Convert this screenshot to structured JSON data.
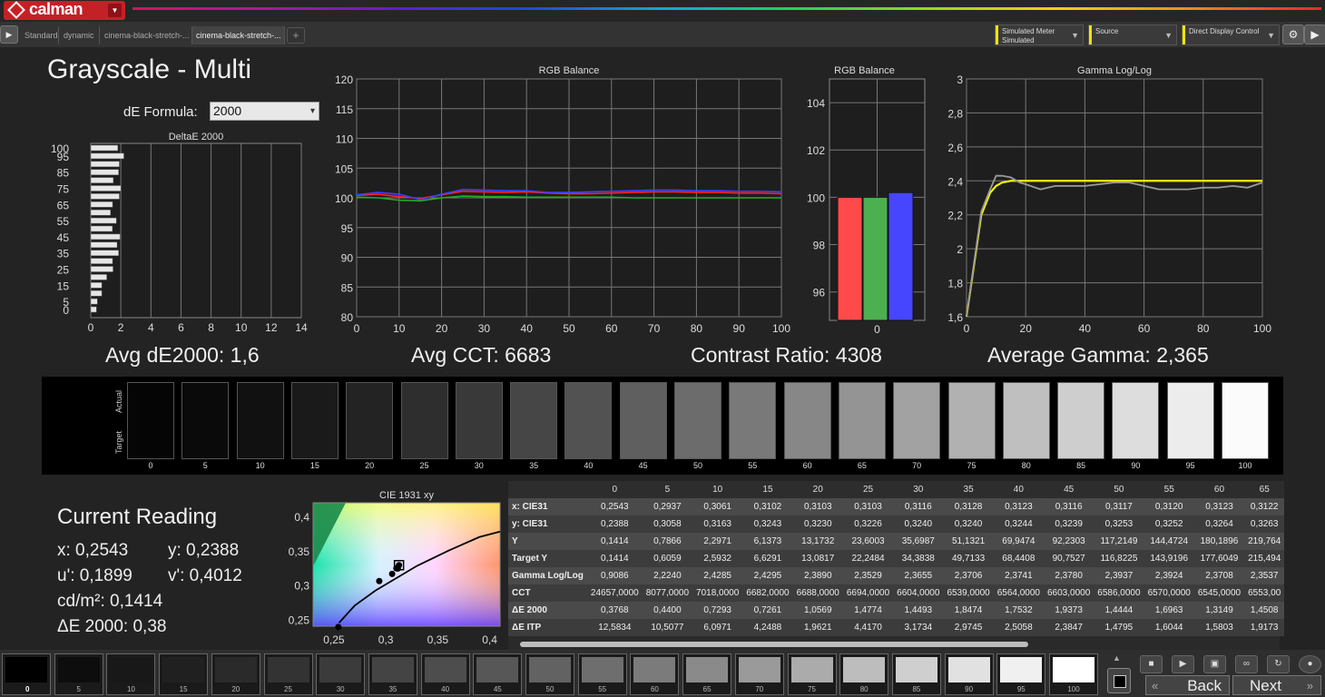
{
  "app": {
    "logo_text": "calman"
  },
  "tabs": [
    {
      "label": "Standard",
      "active": false
    },
    {
      "label": "dynamic",
      "active": false
    },
    {
      "label": "cinema-black-stretch-...",
      "active": false
    },
    {
      "label": "cinema-black-stretch-...",
      "active": true
    }
  ],
  "dropdowns": {
    "meter": {
      "line1": "Simulated Meter",
      "line2": "Simulated"
    },
    "source": {
      "line1": "Source"
    },
    "display": {
      "line1": "Direct Display Control"
    }
  },
  "page": {
    "title": "Grayscale - Multi",
    "de_formula_label": "dE Formula:",
    "de_formula_value": "2000"
  },
  "charts": {
    "deltae": {
      "title": "DeltaE 2000"
    },
    "rgb_line": {
      "title": "RGB Balance"
    },
    "rgb_bar": {
      "title": "RGB Balance"
    },
    "gamma": {
      "title": "Gamma Log/Log"
    },
    "cie": {
      "title": "CIE 1931 xy"
    }
  },
  "stats": {
    "avg_de": "Avg dE2000: 1,6",
    "avg_cct": "Avg CCT: 6683",
    "contrast": "Contrast Ratio: 4308",
    "avg_gamma": "Average Gamma: 2,365"
  },
  "grayscale_strip": {
    "actual_label": "Actual",
    "target_label": "Target",
    "levels": [
      "0",
      "5",
      "10",
      "15",
      "20",
      "25",
      "30",
      "35",
      "40",
      "45",
      "50",
      "55",
      "60",
      "65",
      "70",
      "75",
      "80",
      "85",
      "90",
      "95",
      "100"
    ],
    "colors": [
      "#050505",
      "#0a0a0a",
      "#111111",
      "#1a1a1a",
      "#232323",
      "#2e2e2e",
      "#393939",
      "#464646",
      "#525252",
      "#5f5f5f",
      "#6c6c6c",
      "#797979",
      "#878787",
      "#949494",
      "#a2a2a2",
      "#b1b1b1",
      "#bfbfbf",
      "#cecece",
      "#dddddd",
      "#ececec",
      "#fbfbfb"
    ]
  },
  "current_reading": {
    "title": "Current Reading",
    "x": "x: 0,2543",
    "y": "y: 0,2388",
    "u": "u': 0,1899",
    "v": "v': 0,4012",
    "cd": "cd/m²: 0,1414",
    "de": "ΔE 2000: 0,38"
  },
  "table": {
    "columns": [
      "0",
      "5",
      "10",
      "15",
      "20",
      "25",
      "30",
      "35",
      "40",
      "45",
      "50",
      "55",
      "60",
      "65"
    ],
    "rows": [
      {
        "label": "x: CIE31",
        "values": [
          "0,2543",
          "0,2937",
          "0,3061",
          "0,3102",
          "0,3103",
          "0,3103",
          "0,3116",
          "0,3128",
          "0,3123",
          "0,3116",
          "0,3117",
          "0,3120",
          "0,3123",
          "0,3122"
        ]
      },
      {
        "label": "y: CIE31",
        "values": [
          "0,2388",
          "0,3058",
          "0,3163",
          "0,3243",
          "0,3230",
          "0,3226",
          "0,3240",
          "0,3240",
          "0,3244",
          "0,3239",
          "0,3253",
          "0,3252",
          "0,3264",
          "0,3263"
        ]
      },
      {
        "label": "Y",
        "values": [
          "0,1414",
          "0,7866",
          "2,2971",
          "6,1373",
          "13,1732",
          "23,6003",
          "35,6987",
          "51,1321",
          "69,9474",
          "92,2303",
          "117,2149",
          "144,4724",
          "180,1896",
          "219,764"
        ]
      },
      {
        "label": "Target Y",
        "values": [
          "0,1414",
          "0,6059",
          "2,5932",
          "6,6291",
          "13,0817",
          "22,2484",
          "34,3838",
          "49,7133",
          "68,4408",
          "90,7527",
          "116,8225",
          "143,9196",
          "177,6049",
          "215,494"
        ]
      },
      {
        "label": "Gamma Log/Log",
        "values": [
          "0,9086",
          "2,2240",
          "2,4285",
          "2,4295",
          "2,3890",
          "2,3529",
          "2,3655",
          "2,3706",
          "2,3741",
          "2,3780",
          "2,3937",
          "2,3924",
          "2,3708",
          "2,3537"
        ]
      },
      {
        "label": "CCT",
        "values": [
          "24657,0000",
          "8077,0000",
          "7018,0000",
          "6682,0000",
          "6688,0000",
          "6694,0000",
          "6604,0000",
          "6539,0000",
          "6564,0000",
          "6603,0000",
          "6586,0000",
          "6570,0000",
          "6545,0000",
          "6553,00"
        ]
      },
      {
        "label": "ΔE 2000",
        "values": [
          "0,3768",
          "0,4400",
          "0,7293",
          "0,7261",
          "1,0569",
          "1,4774",
          "1,4493",
          "1,8474",
          "1,7532",
          "1,9373",
          "1,4444",
          "1,6963",
          "1,3149",
          "1,4508"
        ]
      },
      {
        "label": "ΔE ITP",
        "values": [
          "12,5834",
          "10,5077",
          "6,0971",
          "4,2488",
          "1,9621",
          "4,4170",
          "3,1734",
          "2,9745",
          "2,5058",
          "2,3847",
          "1,4795",
          "1,6044",
          "1,5803",
          "1,9173"
        ]
      }
    ]
  },
  "patches": {
    "labels": [
      "0",
      "5",
      "10",
      "15",
      "20",
      "25",
      "30",
      "35",
      "40",
      "45",
      "50",
      "55",
      "60",
      "65",
      "70",
      "75",
      "80",
      "85",
      "90",
      "95",
      "100"
    ],
    "colors": [
      "#000000",
      "#0d0d0d",
      "#181818",
      "#202020",
      "#2a2a2a",
      "#333333",
      "#3b3b3b",
      "#444444",
      "#4d4d4d",
      "#575757",
      "#626262",
      "#6e6e6e",
      "#7b7b7b",
      "#8a8a8a",
      "#9a9a9a",
      "#ababab",
      "#bdbdbd",
      "#cfcfcf",
      "#e1e1e1",
      "#f0f0f0",
      "#ffffff"
    ]
  },
  "nav": {
    "back": "Back",
    "next": "Next"
  },
  "chart_data": [
    {
      "type": "bar",
      "orientation": "horizontal",
      "title": "DeltaE 2000",
      "categories": [
        "0",
        "5",
        "10",
        "15",
        "20",
        "25",
        "30",
        "35",
        "40",
        "45",
        "50",
        "55",
        "60",
        "65",
        "70",
        "75",
        "80",
        "85",
        "90",
        "95",
        "100"
      ],
      "values": [
        0.38,
        0.44,
        0.73,
        0.73,
        1.06,
        1.48,
        1.45,
        1.85,
        1.75,
        1.94,
        1.44,
        1.7,
        1.31,
        1.45,
        1.9,
        2.0,
        1.5,
        1.85,
        1.9,
        2.2,
        1.8
      ],
      "xlim": [
        0,
        14
      ],
      "xticks": [
        "0",
        "2",
        "4",
        "6",
        "8",
        "10",
        "12",
        "14"
      ],
      "yticks": [
        "0",
        "5",
        "15",
        "25",
        "35",
        "45",
        "55",
        "65",
        "75",
        "85",
        "95",
        "100"
      ]
    },
    {
      "type": "line",
      "title": "RGB Balance",
      "x": [
        0,
        5,
        10,
        15,
        20,
        25,
        30,
        35,
        40,
        45,
        50,
        55,
        60,
        65,
        70,
        75,
        80,
        85,
        90,
        95,
        100
      ],
      "series": [
        {
          "color": "#ff2020",
          "values": [
            100.4,
            100.6,
            100.2,
            99.9,
            100.5,
            101.1,
            101.0,
            100.9,
            101.0,
            100.8,
            100.7,
            100.7,
            100.8,
            100.9,
            101.0,
            101.0,
            100.9,
            100.9,
            100.8,
            100.8,
            100.7
          ]
        },
        {
          "color": "#20b020",
          "values": [
            100.1,
            100.0,
            99.6,
            99.5,
            100.0,
            100.3,
            100.2,
            100.2,
            100.1,
            100.1,
            100.1,
            100.1,
            100.1,
            100.0,
            100.0,
            100.0,
            100.0,
            100.0,
            100.0,
            100.0,
            100.0
          ]
        },
        {
          "color": "#4040ff",
          "values": [
            100.5,
            100.9,
            100.6,
            99.7,
            100.6,
            101.4,
            101.3,
            101.2,
            101.2,
            100.9,
            100.9,
            101.0,
            101.1,
            101.2,
            101.3,
            101.3,
            101.2,
            101.2,
            101.1,
            101.1,
            101.0
          ]
        }
      ],
      "ylim": [
        80,
        120
      ],
      "yticks": [
        "80",
        "85",
        "90",
        "95",
        "100",
        "105",
        "110",
        "115",
        "120"
      ],
      "xticks": [
        "0",
        "10",
        "20",
        "30",
        "40",
        "50",
        "60",
        "70",
        "80",
        "90",
        "100"
      ]
    },
    {
      "type": "bar",
      "title": "RGB Balance",
      "categories": [
        "R",
        "G",
        "B"
      ],
      "values": [
        100.0,
        100.0,
        100.2
      ],
      "colors": [
        "#ff4a4a",
        "#4caf50",
        "#4646ff"
      ],
      "ylim": [
        94.8,
        105
      ],
      "yticks": [
        "96",
        "98",
        "100",
        "102",
        "104"
      ],
      "xticks": [
        "0"
      ]
    },
    {
      "type": "line",
      "title": "Gamma Log/Log",
      "x": [
        0,
        5,
        8,
        10,
        12,
        15,
        18,
        20,
        25,
        30,
        35,
        40,
        45,
        50,
        55,
        60,
        65,
        70,
        75,
        80,
        85,
        90,
        95,
        100
      ],
      "series": [
        {
          "color": "#f2f200",
          "values": [
            1.6,
            2.2,
            2.33,
            2.37,
            2.39,
            2.4,
            2.4,
            2.4,
            2.4,
            2.4,
            2.4,
            2.4,
            2.4,
            2.4,
            2.4,
            2.4,
            2.4,
            2.4,
            2.4,
            2.4,
            2.4,
            2.4,
            2.4,
            2.4
          ]
        },
        {
          "color": "#9a9a9a",
          "values": [
            0.91,
            2.22,
            2.35,
            2.43,
            2.43,
            2.42,
            2.39,
            2.38,
            2.35,
            2.37,
            2.37,
            2.37,
            2.38,
            2.39,
            2.39,
            2.37,
            2.35,
            2.35,
            2.35,
            2.36,
            2.36,
            2.37,
            2.36,
            2.39
          ]
        }
      ],
      "ylim": [
        1.6,
        3
      ],
      "yticks": [
        "1,6",
        "1,8",
        "2",
        "2,2",
        "2,4",
        "2,6",
        "2,8",
        "3"
      ],
      "xticks": [
        "0",
        "20",
        "40",
        "60",
        "80",
        "100"
      ]
    },
    {
      "type": "scatter",
      "title": "CIE 1931 xy",
      "x": [
        0.2543,
        0.2937,
        0.3061,
        0.3102,
        0.3116,
        0.3127
      ],
      "y": [
        0.2388,
        0.3058,
        0.3163,
        0.3243,
        0.324,
        0.329
      ],
      "xlim": [
        0.23,
        0.41
      ],
      "ylim": [
        0.24,
        0.42
      ],
      "xticks": [
        "0,25",
        "0,3",
        "0,35",
        "0,4"
      ],
      "yticks": [
        "0,25",
        "0,3",
        "0,35",
        "0,4"
      ]
    }
  ]
}
